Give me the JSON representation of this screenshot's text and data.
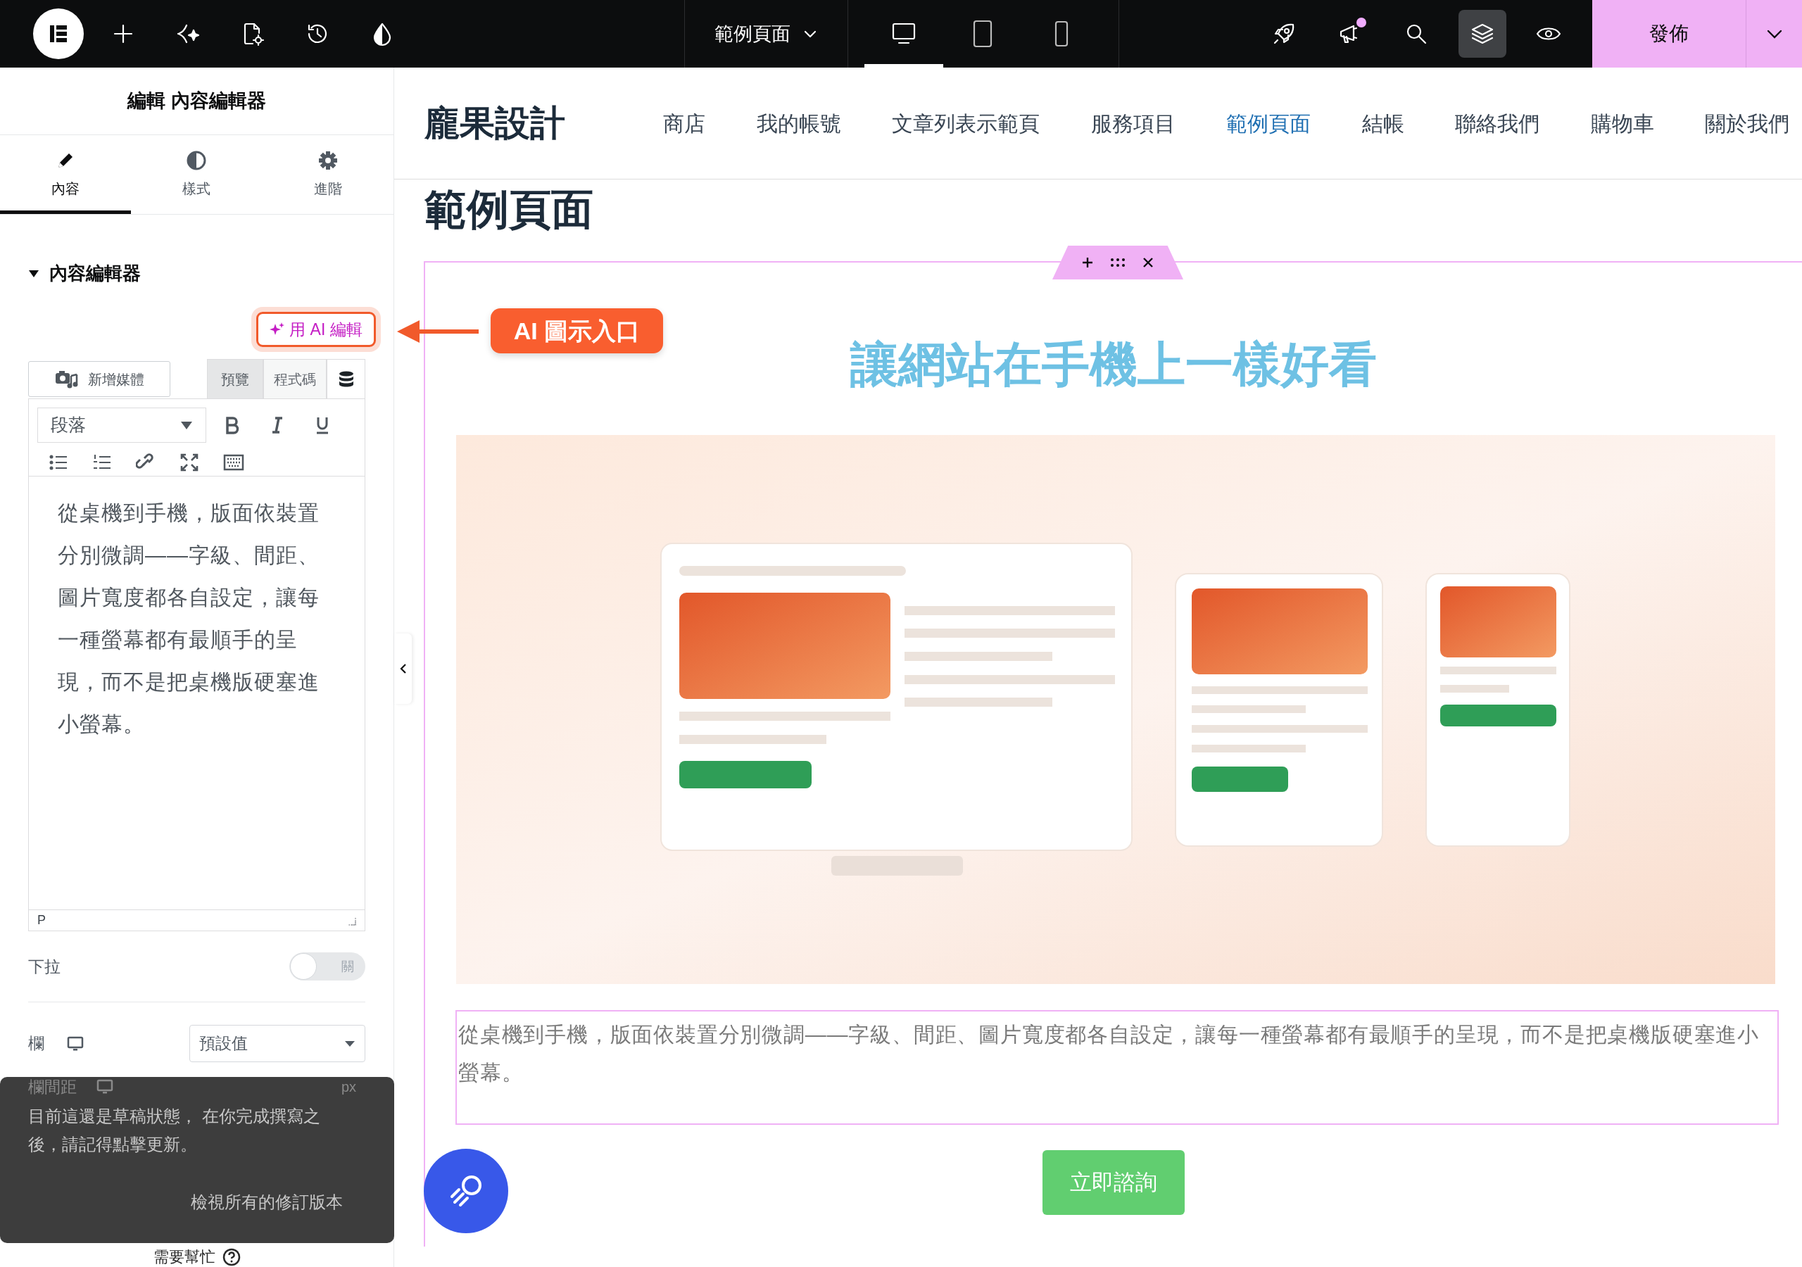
{
  "topbar": {
    "page_selector": "範例頁面",
    "devices": [
      {
        "kind": "desktop",
        "selected": true
      },
      {
        "kind": "tablet",
        "selected": false
      },
      {
        "kind": "mobile",
        "selected": false
      }
    ],
    "notification_dot": true,
    "layers_active": true,
    "publish": "發佈"
  },
  "panel": {
    "title": "編輯 內容編輯器",
    "tabs": [
      {
        "label": "內容",
        "kind": "content",
        "selected": true
      },
      {
        "label": "樣式",
        "kind": "style",
        "selected": false
      },
      {
        "label": "進階",
        "kind": "advanced",
        "selected": false
      }
    ],
    "section": {
      "title": "內容編輯器",
      "expanded": true
    },
    "ai_button": "用 AI 編輯",
    "media_button": "新增媒體",
    "editor_tabs": [
      {
        "label": "預覽",
        "selected": true
      },
      {
        "label": "程式碼",
        "selected": false
      }
    ],
    "format_select": "段落",
    "content": "從桌機到手機，版面依裝置分別微調——字級、間距、圖片寬度都各自設定，讓每一種螢幕都有最順手的呈現，而不是把桌機版硬塞進小螢幕。",
    "status_path": "P",
    "dropcap": {
      "label": "下拉",
      "on": false,
      "state_text": "關"
    },
    "columns": {
      "label": "欄",
      "value": "預設值"
    },
    "column_gap": {
      "label": "欄間距",
      "unit": "px"
    },
    "help": "需要幫忙"
  },
  "annotation": {
    "label": "AI 圖示入口"
  },
  "toast": {
    "message": "目前這還是草稿狀態， 在你完成撰寫之後，請記得點擊更新。",
    "link": "檢視所有的修訂版本"
  },
  "site": {
    "logo": "龐果設計",
    "nav": [
      {
        "label": "商店",
        "selected": false
      },
      {
        "label": "我的帳號",
        "selected": false
      },
      {
        "label": "文章列表示範頁",
        "selected": false
      },
      {
        "label": "服務項目",
        "selected": false
      },
      {
        "label": "範例頁面",
        "selected": true
      },
      {
        "label": "結帳",
        "selected": false
      },
      {
        "label": "聯絡我們",
        "selected": false
      },
      {
        "label": "購物車",
        "selected": false
      },
      {
        "label": "關於我們",
        "selected": false
      }
    ],
    "page_title": "範例頁面",
    "heading": "讓網站在手機上一樣好看",
    "paragraph": "從桌機到手機，版面依裝置分別微調——字級、間距、圖片寬度都各自設定，讓每一種螢幕都有最順手的呈現，而不是把桌機版硬塞進小螢幕。",
    "button": "立即諮詢"
  }
}
